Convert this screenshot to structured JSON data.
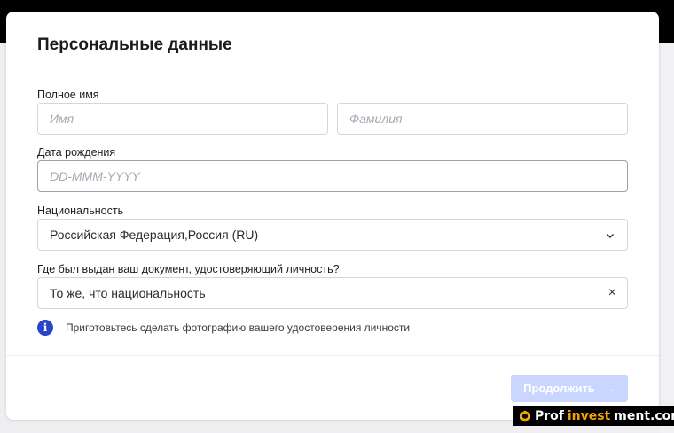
{
  "form": {
    "title": "Персональные данные",
    "full_name_label": "Полное имя",
    "first_name_placeholder": "Имя",
    "last_name_placeholder": "Фамилия",
    "dob_label": "Дата рождения",
    "dob_placeholder": "DD-MMM-YYYY",
    "nationality_label": "Национальность",
    "nationality_value": "Российская Федерация,Россия (RU)",
    "doc_country_label": "Где был выдан ваш документ, удостоверяющий личность?",
    "doc_country_value": "То же, что национальность",
    "clear_glyph": "×",
    "info_glyph": "i",
    "info_text": "Приготовьтесь сделать фотографию вашего удостоверения личности",
    "continue_label": "Продолжить",
    "continue_arrow": "→"
  },
  "watermark": {
    "prefix": "Prof",
    "accent": "invest",
    "suffix": "ment.com"
  },
  "colors": {
    "accent": "#2a43c8",
    "button_disabled": "#c9d6ff",
    "watermark_accent": "#f5a300"
  },
  "icons": {
    "info": "info-icon",
    "chevron": "chevron-down-icon",
    "clear": "close-icon",
    "arrow": "arrow-right-icon",
    "logo": "profinvestment-logo-icon"
  }
}
